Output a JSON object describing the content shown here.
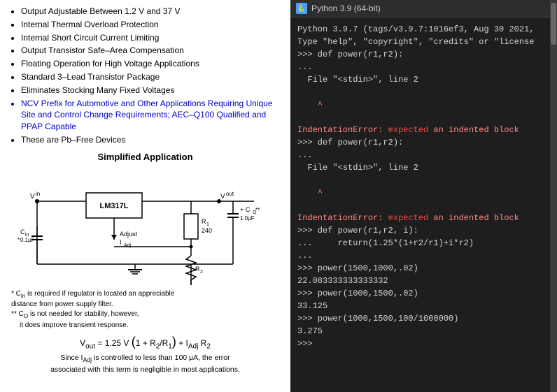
{
  "left": {
    "bullets": [
      {
        "text": "Output Adjustable Between 1.2 V and 37 V",
        "blue": false
      },
      {
        "text": "Internal Thermal Overload Protection",
        "blue": false
      },
      {
        "text": "Internal Short Circuit Current Limiting",
        "blue": false
      },
      {
        "text": "Output Transistor Safe–Area Compensation",
        "blue": false
      },
      {
        "text": "Floating Operation for High Voltage Applications",
        "blue": false
      },
      {
        "text": "Standard 3–Lead Transistor Package",
        "blue": false
      },
      {
        "text": "Eliminates Stocking Many Fixed Voltages",
        "blue": false
      },
      {
        "text": "NCV Prefix for Automotive and Other Applications Requiring Unique Site and Control Change Requirements; AEC–Q100 Qualified and PPAP Capable",
        "blue": true
      },
      {
        "text": "These are Pb–Free Devices",
        "blue": false
      }
    ],
    "section_title": "Simplified Application",
    "footnote1": "* C",
    "footnote1_sub": "in",
    "footnote1_rest": " is required if regulator is located an appreciable distance from power supply filter.",
    "footnote2": "** C",
    "footnote2_sub": "O",
    "footnote2_rest": " is not needed for stability, however,",
    "footnote2_line2": "it does improve transient response.",
    "formula": "V",
    "formula_out": "out",
    "formula_eq": " = 1.25 V",
    "formula_paren": "(1 + R₂/R₁) + I",
    "formula_adj": "Adj",
    "formula_r2": " R₂",
    "since_line1": "Since I",
    "since_adj": "Adj",
    "since_line1_rest": " is controlled to less than 100 μA, the error",
    "since_line2": "associated with this term is negligible in most applications."
  },
  "right": {
    "title": "Python 3.9 (64-bit)",
    "lines": [
      {
        "type": "output",
        "text": "Python 3.9.7 (tags/v3.9.7:1016ef3, Aug 30 2021,"
      },
      {
        "type": "output",
        "text": "Type \"help\", \"copyright\", \"credits\" or \"license"
      },
      {
        "type": "prompt",
        "text": ">>> def power(r1,r2):"
      },
      {
        "type": "continue",
        "text": "..."
      },
      {
        "type": "file",
        "text": "  File \"<stdin>\", line 2"
      },
      {
        "type": "blank",
        "text": ""
      },
      {
        "type": "caret",
        "text": "    ^"
      },
      {
        "type": "blank",
        "text": ""
      },
      {
        "type": "error",
        "text": "IndentationError: expected an indented block"
      },
      {
        "type": "prompt",
        "text": ">>> def power(r1,r2):"
      },
      {
        "type": "continue",
        "text": "..."
      },
      {
        "type": "file",
        "text": "  File \"<stdin>\", line 2"
      },
      {
        "type": "blank",
        "text": ""
      },
      {
        "type": "caret",
        "text": "    ^"
      },
      {
        "type": "blank",
        "text": ""
      },
      {
        "type": "error",
        "text": "IndentationError: expected an indented block"
      },
      {
        "type": "prompt",
        "text": ">>> def power(r1,r2, i):"
      },
      {
        "type": "continue",
        "text": "...     return(1.25*(1+r2/r1)+i*r2)"
      },
      {
        "type": "continue",
        "text": "..."
      },
      {
        "type": "prompt",
        "text": ">>> power(1500,1000,.02)"
      },
      {
        "type": "output",
        "text": "22.083333333333332"
      },
      {
        "type": "prompt",
        "text": ">>> power(1000,1500,.02)"
      },
      {
        "type": "output",
        "text": "33.125"
      },
      {
        "type": "prompt",
        "text": ">>> power(1000,1500,100/1000000)"
      },
      {
        "type": "output",
        "text": "3.275"
      },
      {
        "type": "prompt",
        "text": ">>>"
      }
    ]
  }
}
